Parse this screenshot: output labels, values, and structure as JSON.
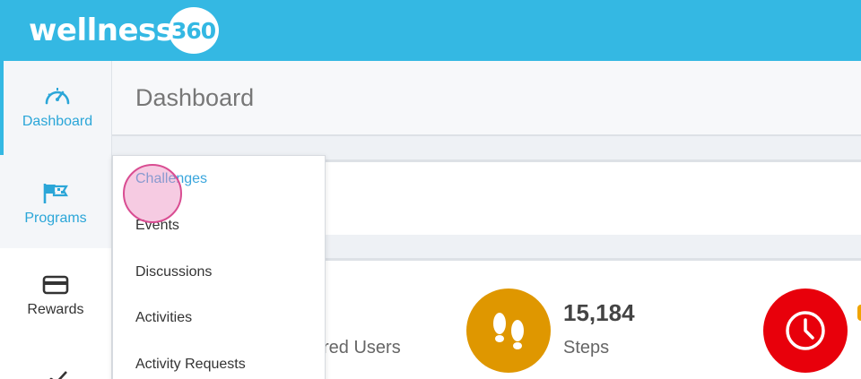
{
  "brand": {
    "logo_word": "wellness",
    "logo_badge": "360",
    "accent": "#34b8e3"
  },
  "sidebar": {
    "items": [
      {
        "label": "Dashboard",
        "icon": "speedometer-icon",
        "active": true
      },
      {
        "label": "Programs",
        "icon": "flags-icon"
      },
      {
        "label": "Rewards",
        "icon": "credit-card-icon"
      },
      {
        "label": "",
        "icon": "chart-line-icon"
      }
    ]
  },
  "page": {
    "title": "Dashboard"
  },
  "dropdown": {
    "items": [
      {
        "label": "Challenges",
        "active": true
      },
      {
        "label": "Events"
      },
      {
        "label": "Discussions"
      },
      {
        "label": "Activities"
      },
      {
        "label": "Activity Requests"
      }
    ]
  },
  "stats": {
    "registered_label": "red Users",
    "steps_value": "15,184",
    "steps_label": "Steps",
    "steps_icon": "footprints-icon",
    "time_icon": "clock-icon"
  },
  "colors": {
    "steps": "#df9700",
    "time": "#e8000b",
    "active_link": "#3aa6dd"
  }
}
